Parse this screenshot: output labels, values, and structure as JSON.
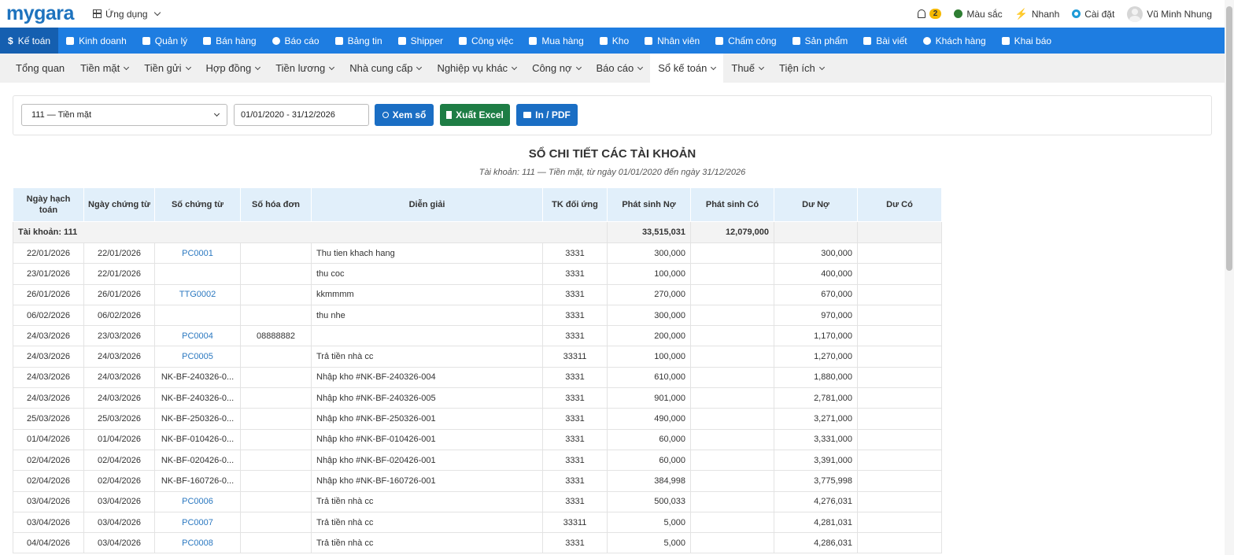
{
  "header": {
    "logo": "mygara",
    "apps_label": "Ứng dụng",
    "notification_count": "2",
    "color_label": "Màu sắc",
    "quick_label": "Nhanh",
    "settings_label": "Cài đặt",
    "user_name": "Vũ Minh Nhung"
  },
  "main_nav": [
    {
      "label": "Kế toán",
      "icon": "dollar-icon",
      "active": true
    },
    {
      "label": "Kinh doanh",
      "icon": "bag-icon"
    },
    {
      "label": "Quản lý",
      "icon": "id-card-icon"
    },
    {
      "label": "Bán hàng",
      "icon": "cart-icon"
    },
    {
      "label": "Báo cáo",
      "icon": "pie-chart-icon"
    },
    {
      "label": "Bảng tin",
      "icon": "home-icon"
    },
    {
      "label": "Shipper",
      "icon": "truck-icon"
    },
    {
      "label": "Công việc",
      "icon": "calendar-icon"
    },
    {
      "label": "Mua hàng",
      "icon": "basket-icon"
    },
    {
      "label": "Kho",
      "icon": "warehouse-icon"
    },
    {
      "label": "Nhân viên",
      "icon": "user-icon"
    },
    {
      "label": "Chấm công",
      "icon": "calendar-check-icon"
    },
    {
      "label": "Sản phẩm",
      "icon": "box-icon"
    },
    {
      "label": "Bài viết",
      "icon": "book-icon"
    },
    {
      "label": "Khách hàng",
      "icon": "smile-icon"
    },
    {
      "label": "Khai báo",
      "icon": "list-icon"
    }
  ],
  "sub_nav": [
    {
      "label": "Tổng quan",
      "dropdown": false
    },
    {
      "label": "Tiền mặt",
      "dropdown": true
    },
    {
      "label": "Tiền gửi",
      "dropdown": true
    },
    {
      "label": "Hợp đồng",
      "dropdown": true
    },
    {
      "label": "Tiền lương",
      "dropdown": true
    },
    {
      "label": "Nhà cung cấp",
      "dropdown": true
    },
    {
      "label": "Nghiệp vụ khác",
      "dropdown": true
    },
    {
      "label": "Công nợ",
      "dropdown": true
    },
    {
      "label": "Báo cáo",
      "dropdown": true
    },
    {
      "label": "Sổ kế toán",
      "dropdown": true,
      "active": true
    },
    {
      "label": "Thuế",
      "dropdown": true
    },
    {
      "label": "Tiện ích",
      "dropdown": true
    }
  ],
  "filter": {
    "account_selected": "111 — Tiền mặt",
    "date_range": "01/01/2020 - 31/12/2026",
    "view_button": "Xem sổ",
    "excel_button": "Xuất Excel",
    "pdf_button": "In / PDF"
  },
  "report": {
    "title": "SỔ CHI TIẾT CÁC TÀI KHOẢN",
    "subtitle": "Tài khoản: 111 — Tiền mặt, từ ngày 01/01/2020 đến ngày 31/12/2026"
  },
  "table": {
    "columns": [
      "Ngày hạch toán",
      "Ngày chứng từ",
      "Số chứng từ",
      "Số hóa đơn",
      "Diễn giải",
      "TK đối ứng",
      "Phát sinh Nợ",
      "Phát sinh Có",
      "Dư Nợ",
      "Dư Có"
    ],
    "summary": {
      "label": "Tài khoản: 111",
      "debit": "33,515,031",
      "credit": "12,079,000"
    },
    "rows": [
      {
        "post_date": "22/01/2026",
        "doc_date": "22/01/2026",
        "doc_no": "PC0001",
        "doc_link": true,
        "invoice": "",
        "desc": "Thu tien khach hang",
        "contra": "3331",
        "debit": "300,000",
        "credit": "",
        "bal_debit": "300,000",
        "bal_credit": ""
      },
      {
        "post_date": "23/01/2026",
        "doc_date": "22/01/2026",
        "doc_no": "",
        "doc_link": false,
        "invoice": "",
        "desc": "thu coc",
        "contra": "3331",
        "debit": "100,000",
        "credit": "",
        "bal_debit": "400,000",
        "bal_credit": ""
      },
      {
        "post_date": "26/01/2026",
        "doc_date": "26/01/2026",
        "doc_no": "TTG0002",
        "doc_link": true,
        "invoice": "",
        "desc": "kkmmmm",
        "contra": "3331",
        "debit": "270,000",
        "credit": "",
        "bal_debit": "670,000",
        "bal_credit": ""
      },
      {
        "post_date": "06/02/2026",
        "doc_date": "06/02/2026",
        "doc_no": "",
        "doc_link": false,
        "invoice": "",
        "desc": "thu nhe",
        "contra": "3331",
        "debit": "300,000",
        "credit": "",
        "bal_debit": "970,000",
        "bal_credit": ""
      },
      {
        "post_date": "24/03/2026",
        "doc_date": "23/03/2026",
        "doc_no": "PC0004",
        "doc_link": true,
        "invoice": "08888882",
        "desc": "",
        "contra": "3331",
        "debit": "200,000",
        "credit": "",
        "bal_debit": "1,170,000",
        "bal_credit": ""
      },
      {
        "post_date": "24/03/2026",
        "doc_date": "24/03/2026",
        "doc_no": "PC0005",
        "doc_link": true,
        "invoice": "",
        "desc": "Trả tiền nhà cc",
        "contra": "33311",
        "debit": "100,000",
        "credit": "",
        "bal_debit": "1,270,000",
        "bal_credit": ""
      },
      {
        "post_date": "24/03/2026",
        "doc_date": "24/03/2026",
        "doc_no": "NK-BF-240326-0...",
        "doc_link": false,
        "invoice": "",
        "desc": "Nhập kho #NK-BF-240326-004",
        "contra": "3331",
        "debit": "610,000",
        "credit": "",
        "bal_debit": "1,880,000",
        "bal_credit": ""
      },
      {
        "post_date": "24/03/2026",
        "doc_date": "24/03/2026",
        "doc_no": "NK-BF-240326-0...",
        "doc_link": false,
        "invoice": "",
        "desc": "Nhập kho #NK-BF-240326-005",
        "contra": "3331",
        "debit": "901,000",
        "credit": "",
        "bal_debit": "2,781,000",
        "bal_credit": ""
      },
      {
        "post_date": "25/03/2026",
        "doc_date": "25/03/2026",
        "doc_no": "NK-BF-250326-0...",
        "doc_link": false,
        "invoice": "",
        "desc": "Nhập kho #NK-BF-250326-001",
        "contra": "3331",
        "debit": "490,000",
        "credit": "",
        "bal_debit": "3,271,000",
        "bal_credit": ""
      },
      {
        "post_date": "01/04/2026",
        "doc_date": "01/04/2026",
        "doc_no": "NK-BF-010426-0...",
        "doc_link": false,
        "invoice": "",
        "desc": "Nhập kho #NK-BF-010426-001",
        "contra": "3331",
        "debit": "60,000",
        "credit": "",
        "bal_debit": "3,331,000",
        "bal_credit": ""
      },
      {
        "post_date": "02/04/2026",
        "doc_date": "02/04/2026",
        "doc_no": "NK-BF-020426-0...",
        "doc_link": false,
        "invoice": "",
        "desc": "Nhập kho #NK-BF-020426-001",
        "contra": "3331",
        "debit": "60,000",
        "credit": "",
        "bal_debit": "3,391,000",
        "bal_credit": ""
      },
      {
        "post_date": "02/04/2026",
        "doc_date": "02/04/2026",
        "doc_no": "NK-BF-160726-0...",
        "doc_link": false,
        "invoice": "",
        "desc": "Nhập kho #NK-BF-160726-001",
        "contra": "3331",
        "debit": "384,998",
        "credit": "",
        "bal_debit": "3,775,998",
        "bal_credit": ""
      },
      {
        "post_date": "03/04/2026",
        "doc_date": "03/04/2026",
        "doc_no": "PC0006",
        "doc_link": true,
        "invoice": "",
        "desc": "Trả tiền nhà cc",
        "contra": "3331",
        "debit": "500,033",
        "credit": "",
        "bal_debit": "4,276,031",
        "bal_credit": ""
      },
      {
        "post_date": "03/04/2026",
        "doc_date": "03/04/2026",
        "doc_no": "PC0007",
        "doc_link": true,
        "invoice": "",
        "desc": "Trả tiền nhà cc",
        "contra": "33311",
        "debit": "5,000",
        "credit": "",
        "bal_debit": "4,281,031",
        "bal_credit": ""
      },
      {
        "post_date": "04/04/2026",
        "doc_date": "03/04/2026",
        "doc_no": "PC0008",
        "doc_link": true,
        "invoice": "",
        "desc": "Trả tiền nhà cc",
        "contra": "3331",
        "debit": "5,000",
        "credit": "",
        "bal_debit": "4,286,031",
        "bal_credit": ""
      }
    ]
  }
}
